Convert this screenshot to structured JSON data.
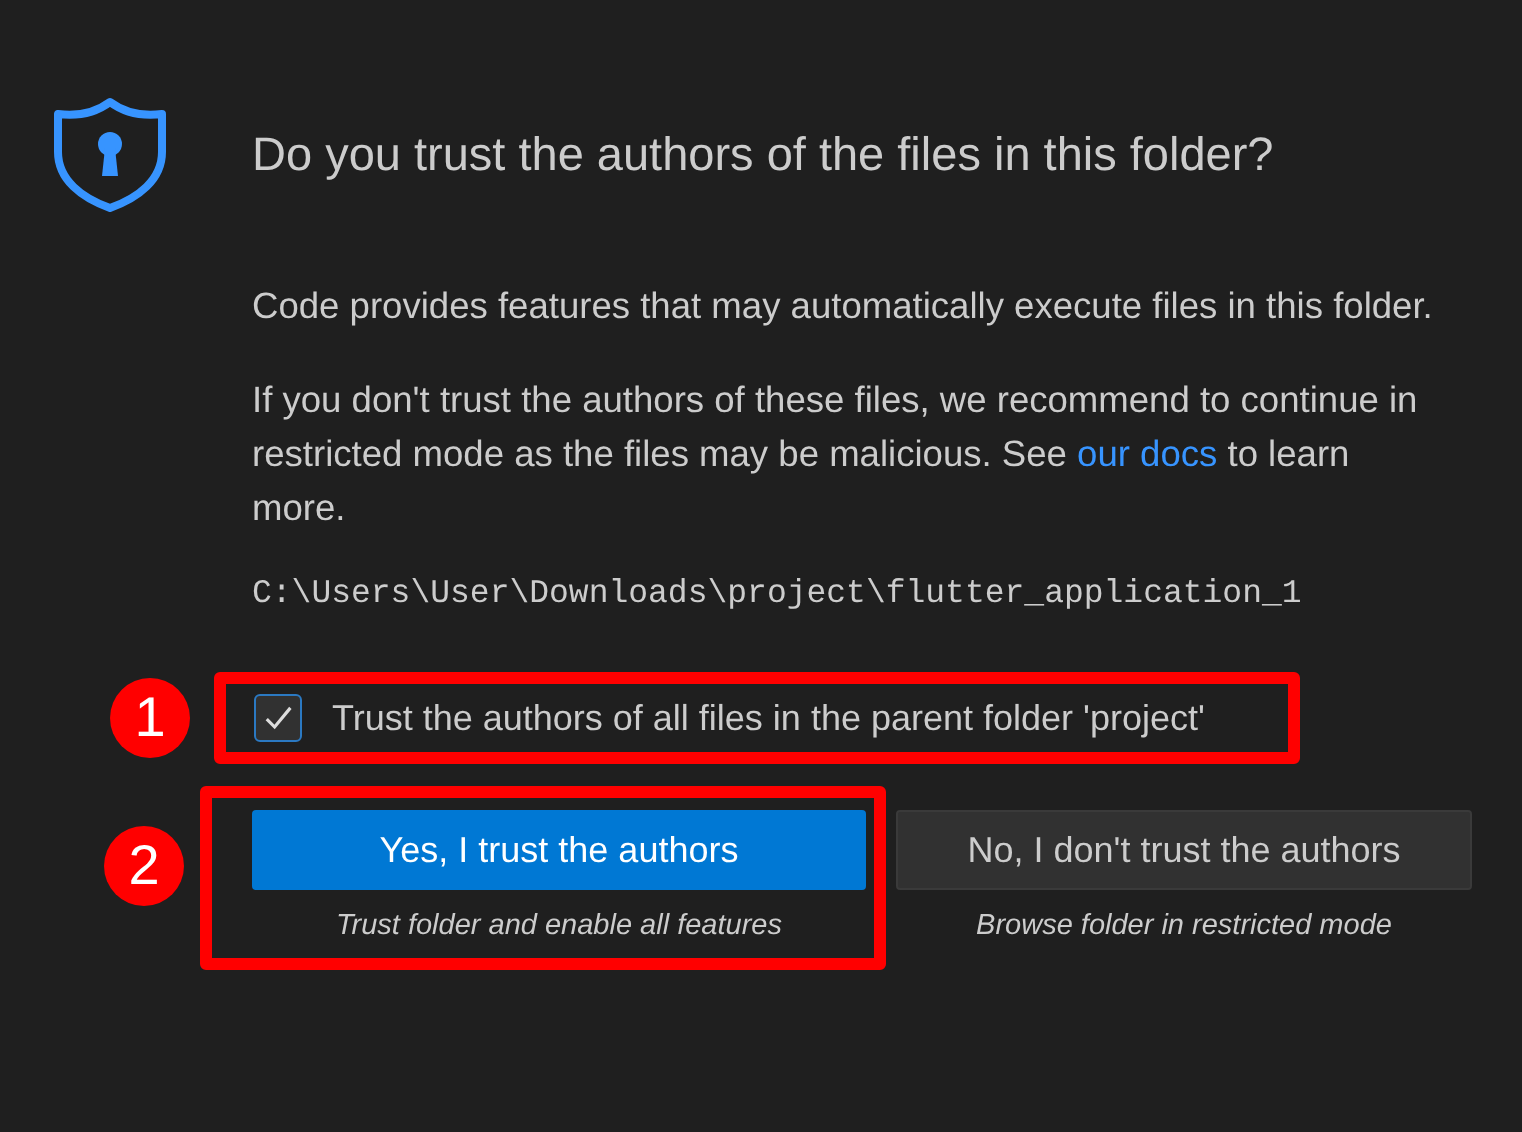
{
  "dialog": {
    "title": "Do you trust the authors of the files in this folder?",
    "paragraphs": [
      {
        "text": "Code provides features that may automatically execute files in this folder."
      },
      {
        "text": "If you don't trust the authors of these files, we recommend to continue in restricted mode as the files may be malicious. See ",
        "link": "our docs",
        "after": " to learn more."
      }
    ],
    "path": "C:\\Users\\User\\Downloads\\project\\flutter_application_1",
    "checkbox": {
      "label": "Trust the authors of all files in the parent folder 'project'",
      "checked": true
    },
    "buttons": [
      {
        "label": "Yes, I trust the authors",
        "caption": "Trust folder and enable all features",
        "kind": "primary"
      },
      {
        "label": "No, I don't trust the authors",
        "caption": "Browse folder in restricted mode",
        "kind": "secondary"
      }
    ]
  },
  "annotations": [
    {
      "number": "1"
    },
    {
      "number": "2"
    }
  ]
}
